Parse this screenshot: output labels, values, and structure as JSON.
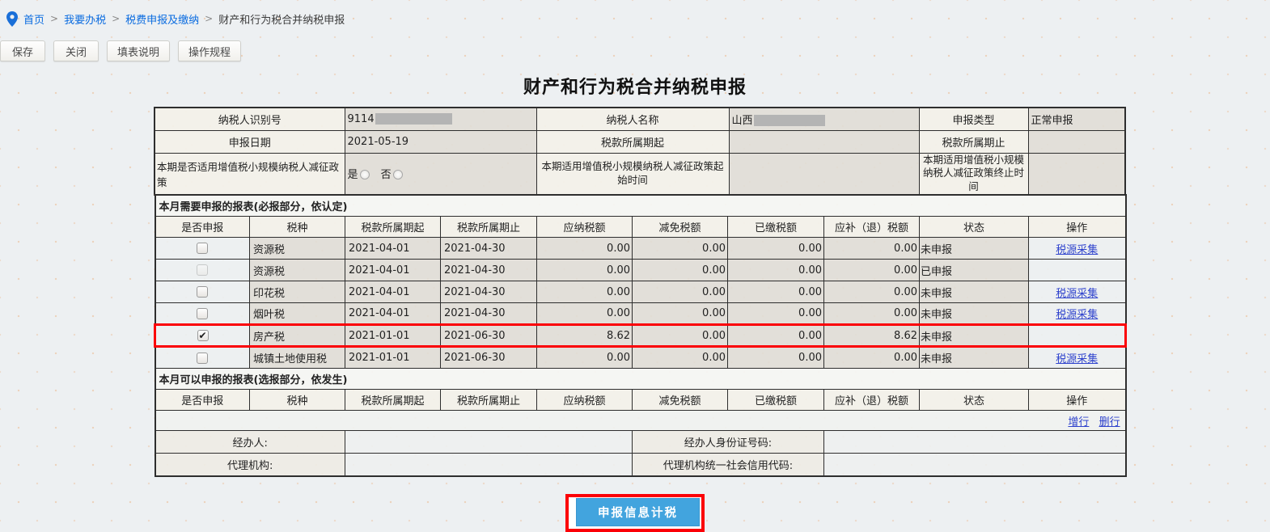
{
  "colors": {
    "breadcrumb_link": "#0b6ce0",
    "action_link": "#2f43cd",
    "highlight_red": "#fb0006",
    "submit_blue": "#42a4de",
    "cell_gray": "#e0ddd6",
    "cell_label": "#f3f1ea"
  },
  "breadcrumb": {
    "pin_icon": "location-pin-icon",
    "separator": ">",
    "items": [
      {
        "label": "首页"
      },
      {
        "label": "我要办税"
      },
      {
        "label": "税费申报及缴纳"
      },
      {
        "label": "财产和行为税合并纳税申报"
      }
    ]
  },
  "toolbar": {
    "save": "保存",
    "close": "关闭",
    "fill_help": "填表说明",
    "procedure": "操作规程"
  },
  "title": "财产和行为税合并纳税申报",
  "info": {
    "taxpayer_id_label": "纳税人识别号",
    "taxpayer_id_value": "9114",
    "taxpayer_name_label": "纳税人名称",
    "taxpayer_name_value": "山西",
    "declare_type_label": "申报类型",
    "declare_type_value": "正常申报",
    "declare_date_label": "申报日期",
    "declare_date_value": "2021-05-19",
    "period_start_label": "税款所属期起",
    "period_start_value": "",
    "period_end_label": "税款所属期止",
    "period_end_value": "",
    "policy_label": "本期是否适用增值税小规模纳税人减征政策",
    "policy_yes": "是",
    "policy_no": "否",
    "policy_start_label": "本期适用增值税小规模纳税人减征政策起始时间",
    "policy_start_value": "",
    "policy_end_label": "本期适用增值税小规模纳税人减征政策终止时间",
    "policy_end_value": ""
  },
  "columns": [
    "是否申报",
    "税种",
    "税款所属期起",
    "税款所属期止",
    "应纳税额",
    "减免税额",
    "已缴税额",
    "应补（退）税额",
    "状态",
    "操作"
  ],
  "required": {
    "title": "本月需要申报的报表(必报部分，依认定)",
    "action_label": "税源采集",
    "check_glyph": "✔",
    "rows": [
      {
        "tax": "资源税",
        "start": "2021-04-01",
        "end": "2021-04-30",
        "payable": "0.00",
        "reduction": "0.00",
        "paid": "0.00",
        "due": "0.00",
        "status": "未申报",
        "action": "税源采集"
      },
      {
        "tax": "资源税",
        "start": "2021-04-01",
        "end": "2021-04-30",
        "payable": "0.00",
        "reduction": "0.00",
        "paid": "0.00",
        "due": "0.00",
        "status": "已申报",
        "action": ""
      },
      {
        "tax": "印花税",
        "start": "2021-04-01",
        "end": "2021-04-30",
        "payable": "0.00",
        "reduction": "0.00",
        "paid": "0.00",
        "due": "0.00",
        "status": "未申报",
        "action": "税源采集"
      },
      {
        "tax": "烟叶税",
        "start": "2021-04-01",
        "end": "2021-04-30",
        "payable": "0.00",
        "reduction": "0.00",
        "paid": "0.00",
        "due": "0.00",
        "status": "未申报",
        "action": "税源采集"
      },
      {
        "tax": "房产税",
        "start": "2021-01-01",
        "end": "2021-06-30",
        "payable": "8.62",
        "reduction": "0.00",
        "paid": "0.00",
        "due": "8.62",
        "status": "未申报",
        "action": ""
      },
      {
        "tax": "城镇土地使用税",
        "start": "2021-01-01",
        "end": "2021-06-30",
        "payable": "0.00",
        "reduction": "0.00",
        "paid": "0.00",
        "due": "0.00",
        "status": "未申报",
        "action": "税源采集"
      }
    ]
  },
  "optional": {
    "title": "本月可以申报的报表(选报部分，依发生)",
    "add_row": "增行",
    "delete_row": "删行"
  },
  "footer": {
    "agent_label": "经办人:",
    "agent_value": "",
    "agent_id_label": "经办人身份证号码:",
    "agent_id_value": "",
    "agency_label": "代理机构:",
    "agency_value": "",
    "agency_code_label": "代理机构统一社会信用代码:",
    "agency_code_value": ""
  },
  "submit": {
    "label": "申报信息计税"
  }
}
